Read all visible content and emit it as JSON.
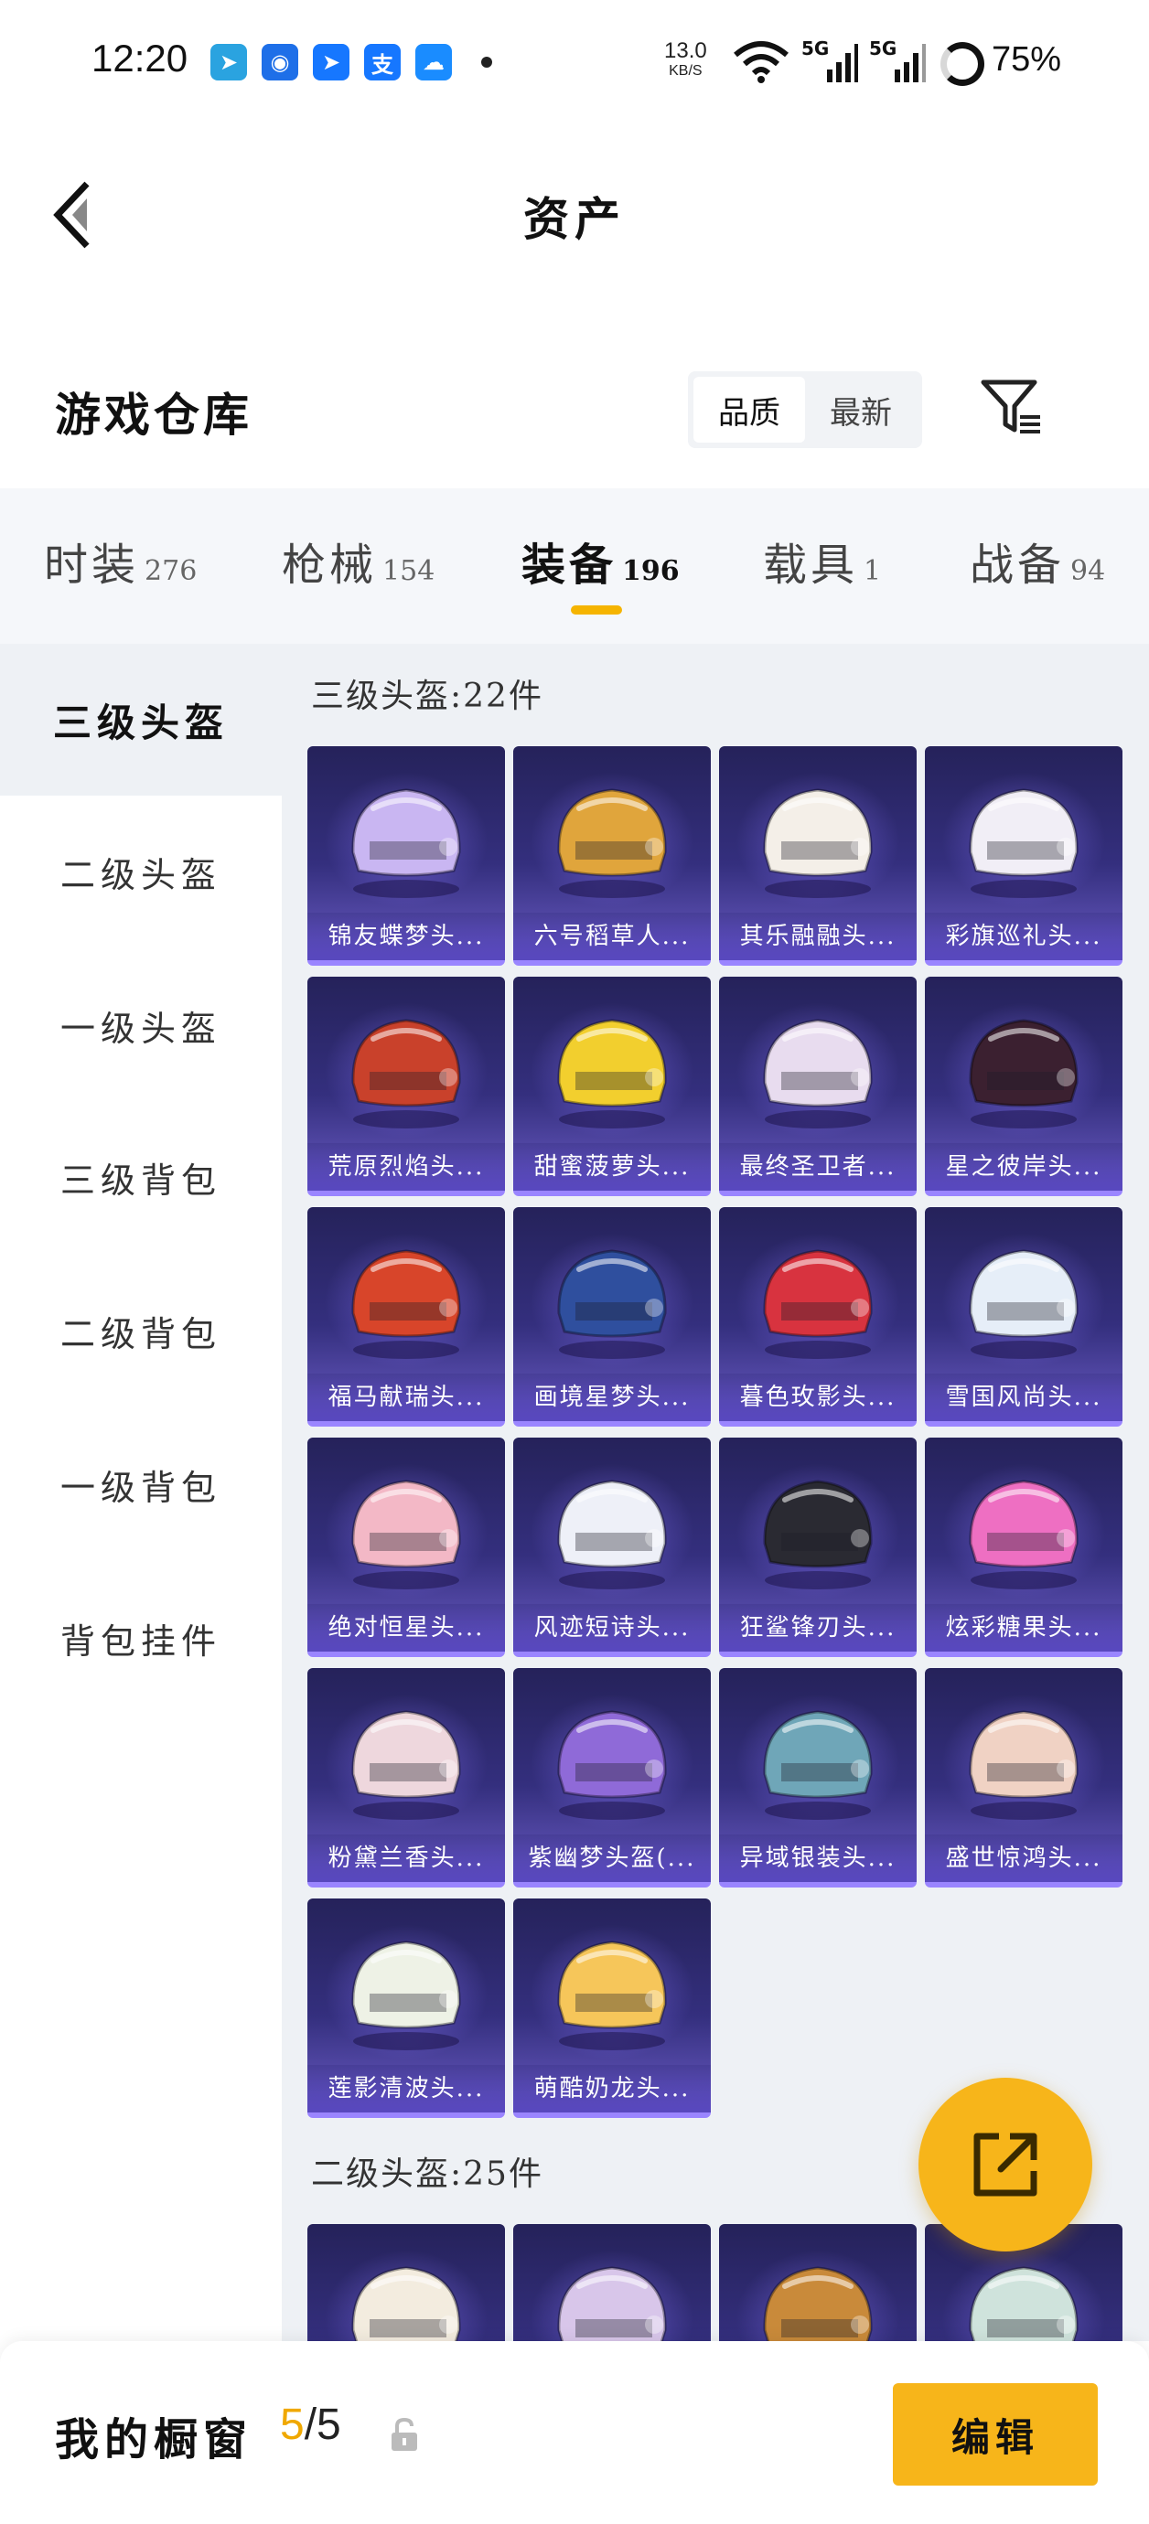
{
  "status_bar": {
    "time": "12:20",
    "apps": [
      {
        "name": "telegram-app-icon",
        "glyph": "➤",
        "color": "#2aa3e0"
      },
      {
        "name": "map-app-icon",
        "glyph": "◉",
        "color": "#1e6fe8"
      },
      {
        "name": "ding-app-icon",
        "glyph": "➤",
        "color": "#1677ff"
      },
      {
        "name": "alipay-app-icon",
        "glyph": "支",
        "color": "#1677ff"
      },
      {
        "name": "cloud-app-icon",
        "glyph": "☁",
        "color": "#1a8cff"
      }
    ],
    "net_speed_value": "13.0",
    "net_speed_unit": "KB/S",
    "battery": "75%"
  },
  "header": {
    "title": "资产"
  },
  "warehouse": {
    "title": "游戏仓库",
    "sort_options": [
      "品质",
      "最新"
    ],
    "sort_active": "品质"
  },
  "categories": [
    {
      "name": "时装",
      "count": "276"
    },
    {
      "name": "枪械",
      "count": "154"
    },
    {
      "name": "装备",
      "count": "196"
    },
    {
      "name": "载具",
      "count": "1"
    },
    {
      "name": "战备",
      "count": "94"
    }
  ],
  "active_category": "装备",
  "side_nav": [
    "三级头盔",
    "二级头盔",
    "一级头盔",
    "三级背包",
    "二级背包",
    "一级背包",
    "背包挂件"
  ],
  "side_active": "三级头盔",
  "sections": [
    {
      "title": "三级头盔:22件",
      "items": [
        {
          "name": "锦友蝶梦头...",
          "color": "#c9b6f2"
        },
        {
          "name": "六号稻草人...",
          "color": "#e0a53c"
        },
        {
          "name": "其乐融融头...",
          "color": "#f4efe8"
        },
        {
          "name": "彩旗巡礼头...",
          "color": "#f1eef6"
        },
        {
          "name": "荒原烈焰头...",
          "color": "#c9412b"
        },
        {
          "name": "甜蜜菠萝头...",
          "color": "#f2cf2e"
        },
        {
          "name": "最终圣卫者...",
          "color": "#e8dcef"
        },
        {
          "name": "星之彼岸头...",
          "color": "#3b2030"
        },
        {
          "name": "福马献瑞头...",
          "color": "#d8452a"
        },
        {
          "name": "画境星梦头...",
          "color": "#2f4f9e"
        },
        {
          "name": "暮色玫影头...",
          "color": "#d8333f"
        },
        {
          "name": "雪国风尚头...",
          "color": "#e6eef8"
        },
        {
          "name": "绝对恒星头...",
          "color": "#f3b8c6"
        },
        {
          "name": "风迹短诗头...",
          "color": "#eef0f8"
        },
        {
          "name": "狂鲨锋刃头...",
          "color": "#2a2a32"
        },
        {
          "name": "炫彩糖果头...",
          "color": "#ee6fc2"
        },
        {
          "name": "粉黛兰香头...",
          "color": "#eed7dd"
        },
        {
          "name": "紫幽梦头盔(...",
          "color": "#8f6ad8"
        },
        {
          "name": "异域银装头...",
          "color": "#6fa6b8"
        },
        {
          "name": "盛世惊鸿头...",
          "color": "#f0d2c4"
        },
        {
          "name": "莲影清波头...",
          "color": "#eef2e6"
        },
        {
          "name": "萌酷奶龙头...",
          "color": "#f6c65a"
        }
      ]
    },
    {
      "title": "二级头盔:25件",
      "items": [
        {
          "name": "",
          "color": "#f3ecdf"
        },
        {
          "name": "",
          "color": "#d8c6ea"
        },
        {
          "name": "",
          "color": "#c98a3a"
        },
        {
          "name": "",
          "color": "#cfe3dc"
        }
      ]
    }
  ],
  "bottom": {
    "showcase_label": "我的橱窗",
    "showcase_current": "5",
    "showcase_total": "/5",
    "edit_label": "编辑"
  },
  "colors": {
    "accent": "#f7b51a",
    "card_border": "#9a85ff"
  }
}
